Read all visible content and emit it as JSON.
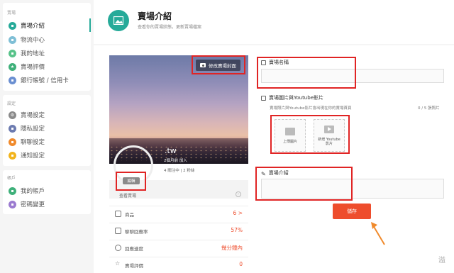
{
  "sidebar": {
    "section1_heading": "賣場",
    "section2_heading": "設定",
    "section3_heading": "帳戶",
    "items": [
      {
        "label": "賣場介紹",
        "color": "#26aa99"
      },
      {
        "label": "物流中心",
        "color": "#7fbfd6"
      },
      {
        "label": "我的地址",
        "color": "#58c38a"
      },
      {
        "label": "賣場評價",
        "color": "#3fb07a"
      },
      {
        "label": "銀行帳號 / 信用卡",
        "color": "#6a8fd1"
      },
      {
        "label": "賣場設定",
        "color": "#8a8a8a"
      },
      {
        "label": "隱私設定",
        "color": "#6c7bb0"
      },
      {
        "label": "聊聊設定",
        "color": "#f08a2c"
      },
      {
        "label": "通知設定",
        "color": "#f2b41c"
      },
      {
        "label": "我的帳戶",
        "color": "#3fb07a"
      },
      {
        "label": "密碼變更",
        "color": "#9b7bd0"
      }
    ]
  },
  "header": {
    "title": "賣場介紹",
    "subtitle": "查看你的賣場狀態，更新賣場檔案"
  },
  "shop_card": {
    "edit_cover_label": "修改賣場封面",
    "shop_name": ".tw",
    "meta_joined": "2個月前 加入",
    "meta_followers": "4 關注中 | 2 粉絲",
    "edit_badge": "編輯",
    "visit_shop": "查看賣場",
    "stats": [
      {
        "label": "商品",
        "value": "6 >"
      },
      {
        "label": "聊聊回應率",
        "value": "57%"
      },
      {
        "label": "回應速度",
        "value": "幾分鐘內"
      },
      {
        "label": "賣場評價",
        "value": "0"
      }
    ]
  },
  "form": {
    "shop_name_label": "賣場名稱",
    "media_label": "賣場圖片與Youtube影片",
    "media_hint": "賣場照片與Youtube影片會出現在你的賣場首頁",
    "media_count": "0 / 5 張照片",
    "upload_image_label": "上傳圖片",
    "youtube_label_line1": "新增 Youtube",
    "youtube_label_line2": "影片",
    "intro_label": "賣場介紹",
    "save_label": "儲存"
  },
  "colors": {
    "accent": "#26aa99",
    "primary_button": "#ee4d2d",
    "annotation_red": "#e02424",
    "annotation_arrow": "#f08a2c"
  }
}
